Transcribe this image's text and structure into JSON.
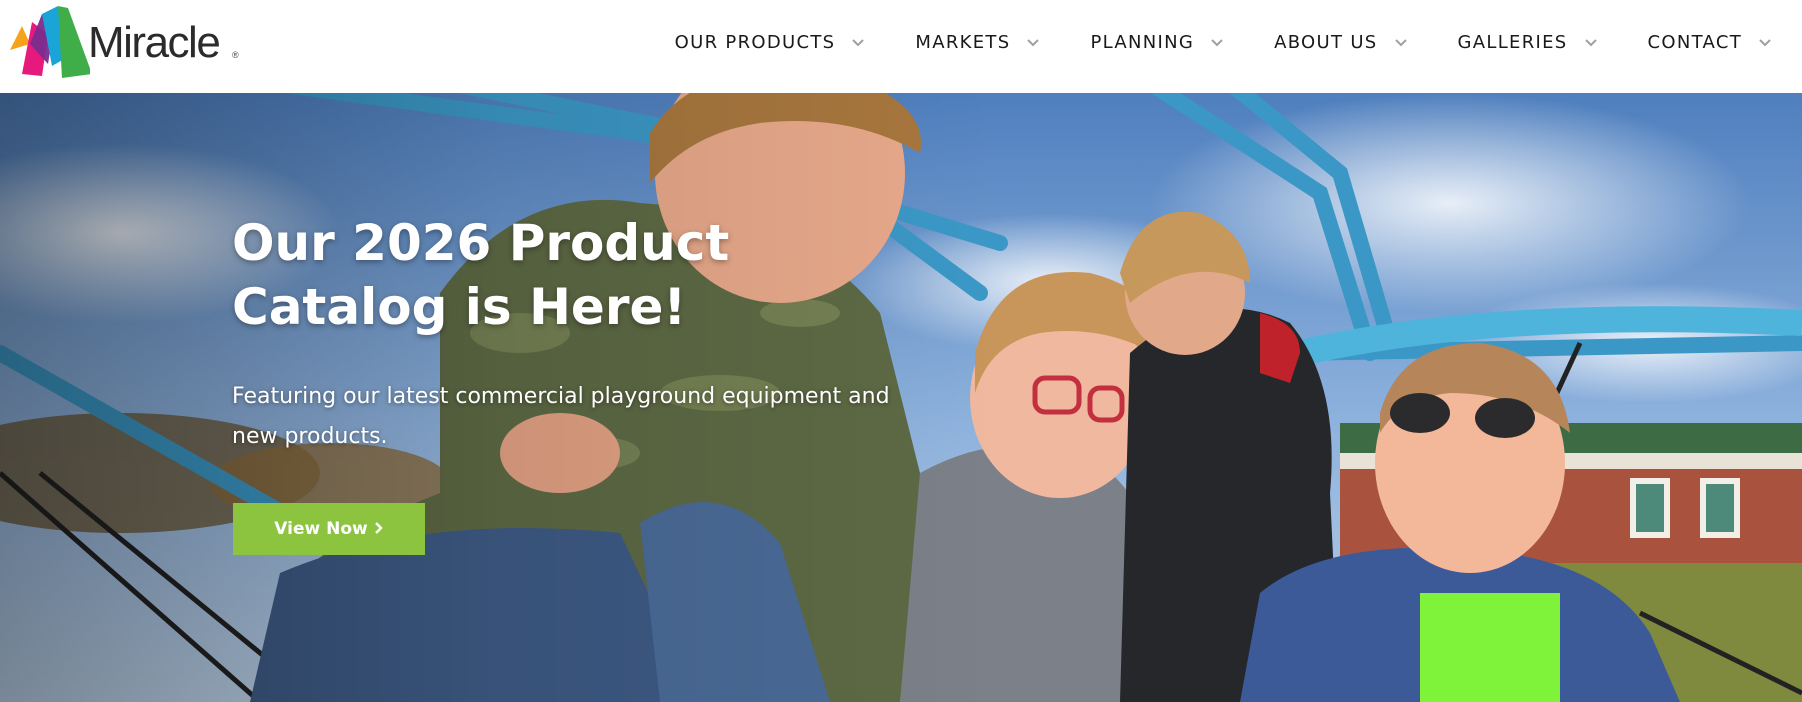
{
  "brand": {
    "name": "Miracle",
    "reg_mark": "®",
    "logo_colors": [
      "#f7a21b",
      "#e6197d",
      "#7b2c8f",
      "#1ba4d8",
      "#3fae49"
    ]
  },
  "nav": {
    "items": [
      {
        "label": "OUR PRODUCTS",
        "icon": "chevron-down-icon"
      },
      {
        "label": "MARKETS",
        "icon": "chevron-down-icon"
      },
      {
        "label": "PLANNING",
        "icon": "chevron-down-icon"
      },
      {
        "label": "ABOUT US",
        "icon": "chevron-down-icon"
      },
      {
        "label": "GALLERIES",
        "icon": "chevron-down-icon"
      },
      {
        "label": "CONTACT",
        "icon": "chevron-down-icon"
      }
    ]
  },
  "hero": {
    "title_line1": "Our 2026 Product",
    "title_line2": "Catalog is Here!",
    "subtitle_line1": "Featuring our latest commercial playground equipment and",
    "subtitle_line2": "new products.",
    "cta_label": "View Now",
    "cta_icon": "chevron-right-icon",
    "cta_color": "#8cc43f"
  },
  "colors": {
    "nav_text": "#1a1a1a",
    "chevron": "#a0a0a0",
    "playground_blue": "#3b98c6"
  }
}
